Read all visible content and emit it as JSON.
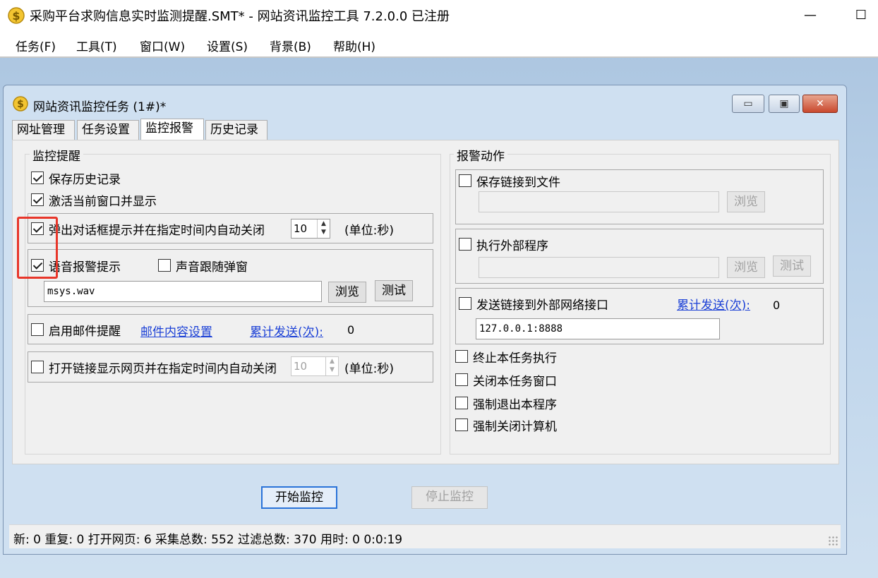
{
  "window": {
    "title": "采购平台求购信息实时监测提醒.SMT* - 网站资讯监控工具 7.2.0.0  已注册",
    "minimize": "—",
    "maximize": "☐"
  },
  "menu": [
    "任务(F)",
    "工具(T)",
    "窗口(W)",
    "设置(S)",
    "背景(B)",
    "帮助(H)"
  ],
  "child": {
    "title": "网站资讯监控任务  (1#)*",
    "buttons": {
      "minimize": "▭",
      "restore": "▣",
      "close": "✕"
    }
  },
  "tabs": [
    "网址管理",
    "任务设置",
    "监控报警",
    "历史记录"
  ],
  "active_tab": "监控报警",
  "left": {
    "group_title": "监控提醒",
    "save_history": {
      "label": "保存历史记录",
      "checked": true
    },
    "activate_window": {
      "label": "激活当前窗口并显示",
      "checked": true
    },
    "popup": {
      "label": "弹出对话框提示并在指定时间内自动关闭",
      "checked": true,
      "seconds": "10",
      "unit": "(单位:秒)"
    },
    "voice": {
      "label": "语音报警提示",
      "checked": true,
      "follow_label": "声音跟随弹窗",
      "follow_checked": false,
      "file": "msys.wav",
      "browse": "浏览",
      "test": "测试"
    },
    "mail": {
      "label": "启用邮件提醒",
      "checked": false,
      "settings_link": "邮件内容设置",
      "sent_label": "累计发送(次):",
      "sent_value": "0"
    },
    "open_link": {
      "label": "打开链接显示网页并在指定时间内自动关闭",
      "checked": false,
      "seconds": "10",
      "unit": "(单位:秒)"
    }
  },
  "right": {
    "group_title": "报警动作",
    "save_link": {
      "label": "保存链接到文件",
      "checked": false,
      "browse": "浏览"
    },
    "exec": {
      "label": "执行外部程序",
      "checked": false,
      "browse": "浏览",
      "test": "测试"
    },
    "send": {
      "label": "发送链接到外部网络接口",
      "checked": false,
      "sent_label": "累计发送(次):",
      "sent_value": "0",
      "address": "127.0.0.1:8888"
    },
    "terminate": {
      "label": "终止本任务执行",
      "checked": false
    },
    "close_window": {
      "label": "关闭本任务窗口",
      "checked": false
    },
    "force_exit": {
      "label": "强制退出本程序",
      "checked": false
    },
    "shutdown": {
      "label": "强制关闭计算机",
      "checked": false
    }
  },
  "actions": {
    "start": "开始监控",
    "stop": "停止监控"
  },
  "status": "新:  0  重复:  0  打开网页:  6  采集总数:  552  过滤总数:  370  用时:  0 0:0:19",
  "colors": {
    "highlight": "#e8362a",
    "link": "#1a3fd6",
    "child_bg": "#cfe0f1"
  }
}
